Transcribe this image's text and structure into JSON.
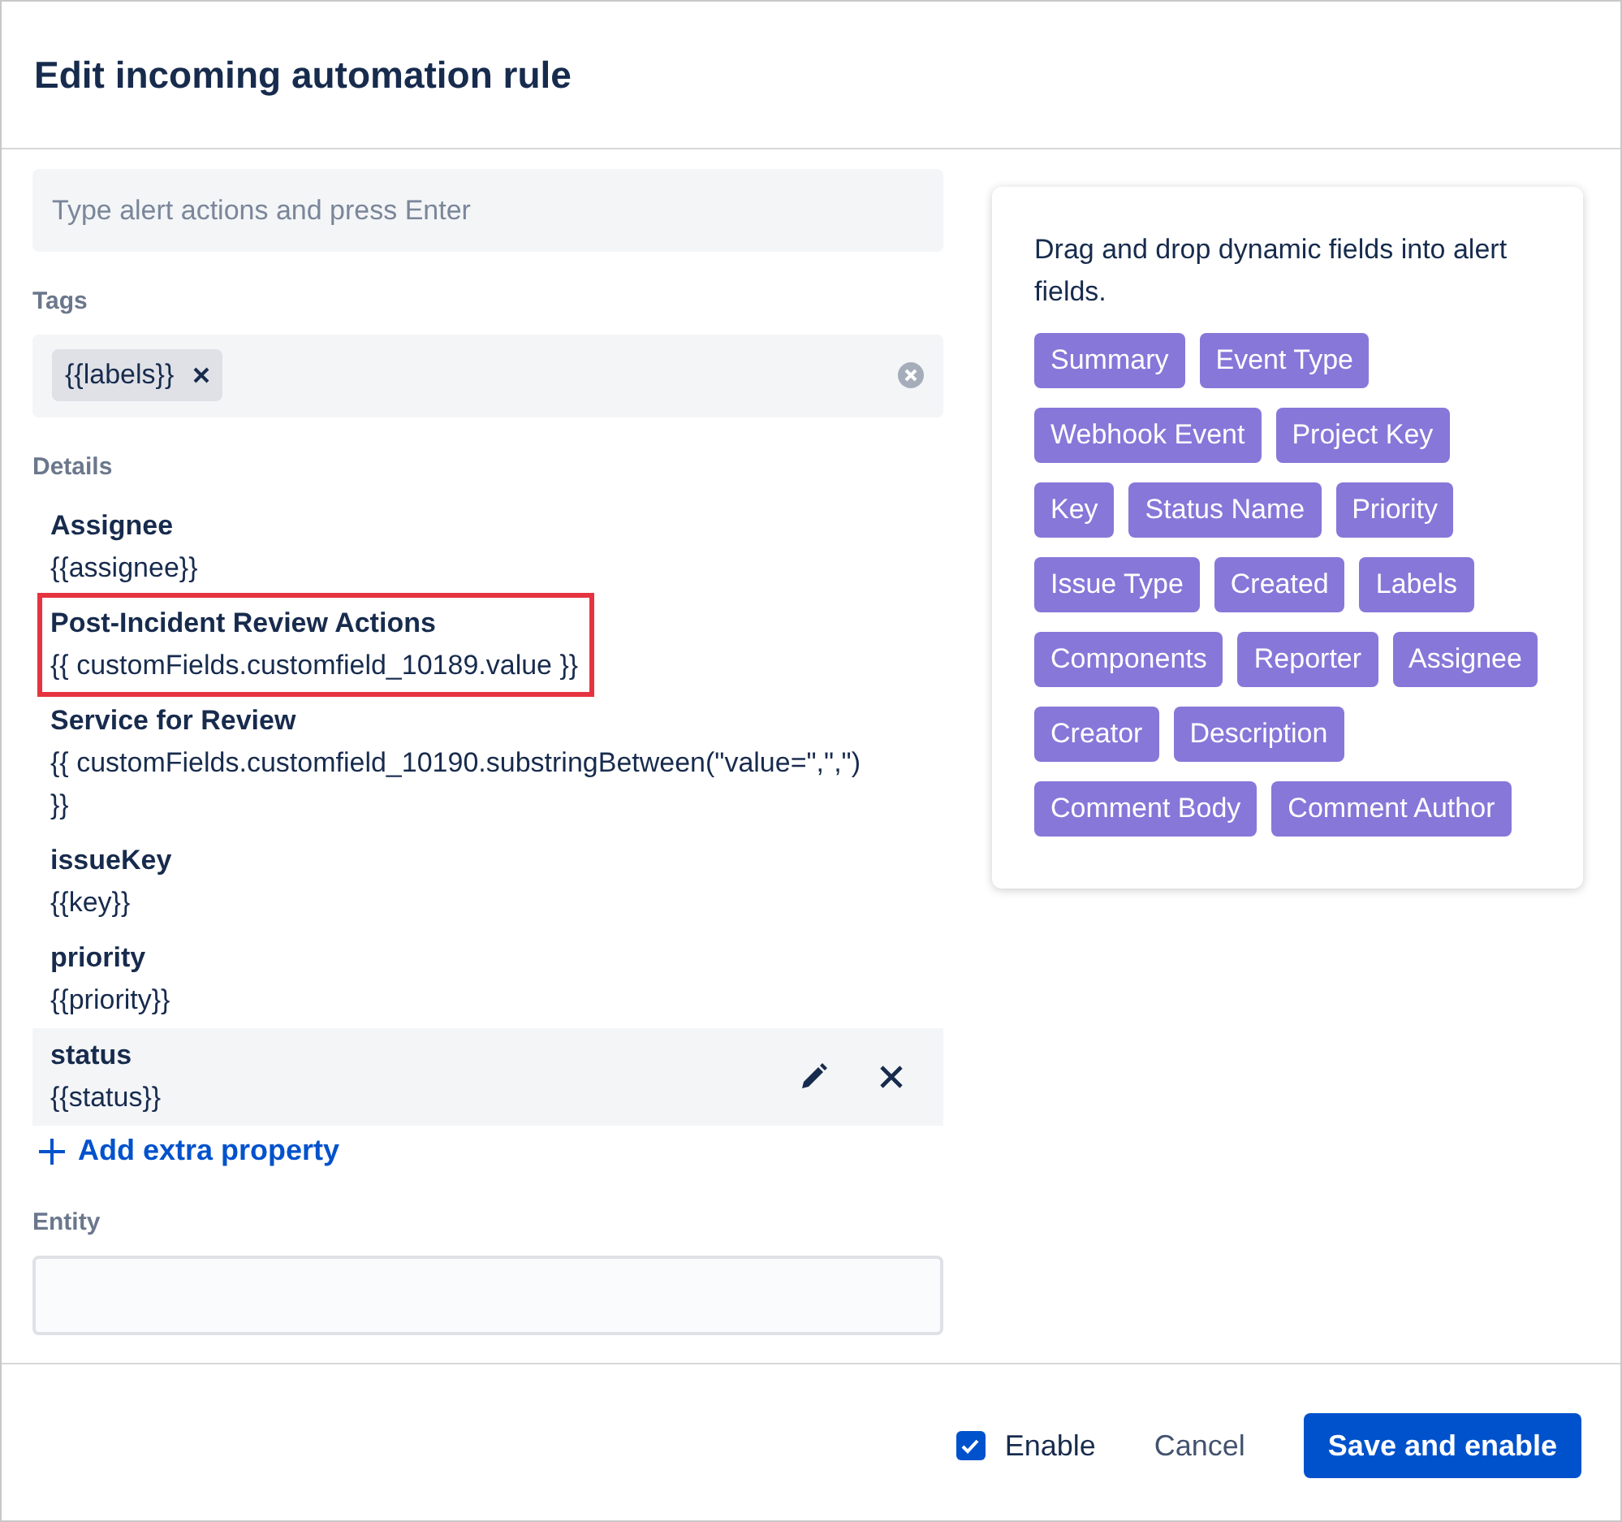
{
  "dialog": {
    "title": "Edit incoming automation rule"
  },
  "actions_field": {
    "placeholder": "Type alert actions and press Enter"
  },
  "tags": {
    "label": "Tags",
    "items": [
      "{{labels}}"
    ]
  },
  "details": {
    "label": "Details",
    "items": [
      {
        "name": "Assignee",
        "value": "{{assignee}}",
        "highlighted": false,
        "hovered": false
      },
      {
        "name": "Post-Incident Review Actions",
        "value": "{{ customFields.customfield_10189.value }}",
        "highlighted": true,
        "hovered": false
      },
      {
        "name": "Service for Review",
        "value": "{{ customFields.customfield_10190.substringBetween(\"value=\",\",\") }}",
        "highlighted": false,
        "hovered": false
      },
      {
        "name": "issueKey",
        "value": "{{key}}",
        "highlighted": false,
        "hovered": false
      },
      {
        "name": "priority",
        "value": "{{priority}}",
        "highlighted": false,
        "hovered": false
      },
      {
        "name": "status",
        "value": "{{status}}",
        "highlighted": false,
        "hovered": true
      }
    ],
    "add_link": "Add extra property"
  },
  "entity": {
    "label": "Entity"
  },
  "dynamic_fields": {
    "hint": "Drag and drop dynamic fields into alert fields.",
    "fields": [
      "Summary",
      "Event Type",
      "Webhook Event",
      "Project Key",
      "Key",
      "Status Name",
      "Priority",
      "Issue Type",
      "Created",
      "Labels",
      "Components",
      "Reporter",
      "Assignee",
      "Creator",
      "Description",
      "Comment Body",
      "Comment Author"
    ]
  },
  "footer": {
    "enable": {
      "label": "Enable",
      "checked": true
    },
    "cancel": "Cancel",
    "save": "Save and enable"
  }
}
